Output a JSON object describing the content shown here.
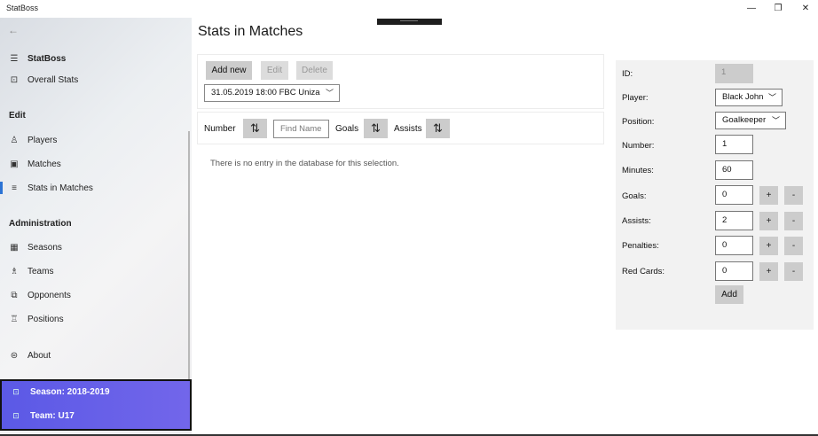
{
  "window": {
    "title": "StatBoss",
    "minimize_glyph": "—",
    "restore_glyph": "❐",
    "close_glyph": "✕"
  },
  "sidebar": {
    "back_glyph": "←",
    "app_name": "StatBoss",
    "overall_stats": "Overall Stats",
    "edit_header": "Edit",
    "players": "Players",
    "matches": "Matches",
    "stats_in_matches": "Stats in Matches",
    "admin_header": "Administration",
    "seasons": "Seasons",
    "teams": "Teams",
    "opponents": "Opponents",
    "positions": "Positions",
    "about": "About",
    "season": "Season: 2018-2019",
    "team": "Team: U17"
  },
  "main": {
    "title": "Stats in Matches",
    "add_new": "Add new",
    "edit": "Edit",
    "delete": "Delete",
    "match_selected": "31.05.2019 18:00 FBC Uniza",
    "sort_number": "Number",
    "find_placeholder": "Find Name",
    "sort_goals": "Goals",
    "sort_assists": "Assists",
    "empty_message": "There is no entry in the database for this selection."
  },
  "detail": {
    "id_label": "ID:",
    "id_value": "1",
    "player_label": "Player:",
    "player_value": "Black John",
    "position_label": "Position:",
    "position_value": "Goalkeeper",
    "number_label": "Number:",
    "number_value": "1",
    "minutes_label": "Minutes:",
    "minutes_value": "60",
    "goals_label": "Goals:",
    "goals_value": "0",
    "assists_label": "Assists:",
    "assists_value": "2",
    "penalties_label": "Penalties:",
    "penalties_value": "0",
    "red_cards_label": "Red Cards:",
    "red_cards_value": "0",
    "plus": "+",
    "minus": "-",
    "add": "Add"
  },
  "colors": {
    "accent": "#2b73d4",
    "season_box": "#6461e8",
    "button_gray": "#cccccc"
  }
}
